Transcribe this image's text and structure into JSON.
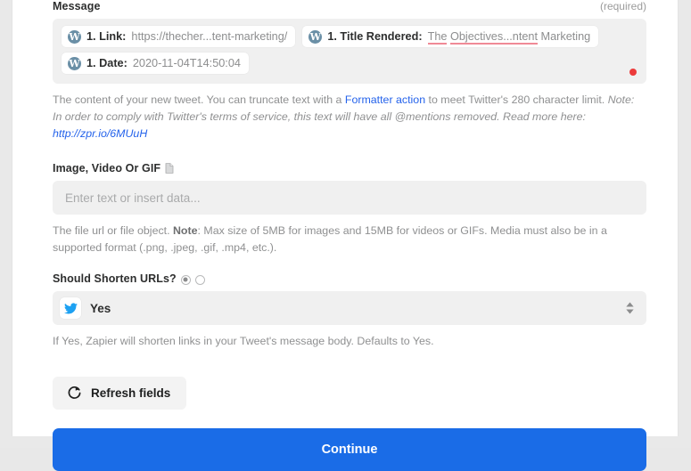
{
  "message_field": {
    "label": "Message",
    "required_tag": "(required)",
    "tokens": [
      {
        "icon": "wordpress-icon",
        "index": "1. Link:",
        "value": "https://thecher...tent-marketing/"
      },
      {
        "icon": "wordpress-icon",
        "index": "1. Title Rendered:",
        "value_pre": "The",
        "value_mid": "Objectives...ntent",
        "value_post": "Marketing"
      },
      {
        "icon": "wordpress-icon",
        "index": "1. Date:",
        "value": "2020-11-04T14:50:04"
      }
    ],
    "helper": {
      "part1": "The content of your new tweet. You can truncate text with a ",
      "link": "Formatter action",
      "part2": " to meet Twitter's 280 character limit. ",
      "note_italic": "Note: In order to comply with Twitter's terms of service, this text will have all @mentions removed. Read more here: ",
      "note_link": "http://zpr.io/6MUuH"
    }
  },
  "image_field": {
    "label": "Image, Video Or GIF",
    "icon": "file-icon",
    "placeholder": "Enter text or insert data...",
    "value": "",
    "helper_part1": "The file url or file object. ",
    "helper_bold": "Note",
    "helper_part2": ": Max size of 5MB for images and 15MB for videos or GIFs. Media must also be in a supported format (.png, .jpeg, .gif, .mp4, etc.)."
  },
  "shorten_field": {
    "label": "Should Shorten URLs?",
    "radio_selected_index": 0,
    "selected_value": "Yes",
    "app_icon": "twitter-icon",
    "helper": "If Yes, Zapier will shorten links in your Tweet's message body. Defaults to Yes."
  },
  "actions": {
    "refresh_label": "Refresh fields",
    "refresh_icon": "refresh-icon",
    "continue_label": "Continue"
  },
  "colors": {
    "accent_blue": "#1a6ce7",
    "link_blue": "#2563eb",
    "twitter_blue": "#1da1f2",
    "spellcheck_red": "#f08a96",
    "alert_dot": "#ec3b3b"
  }
}
